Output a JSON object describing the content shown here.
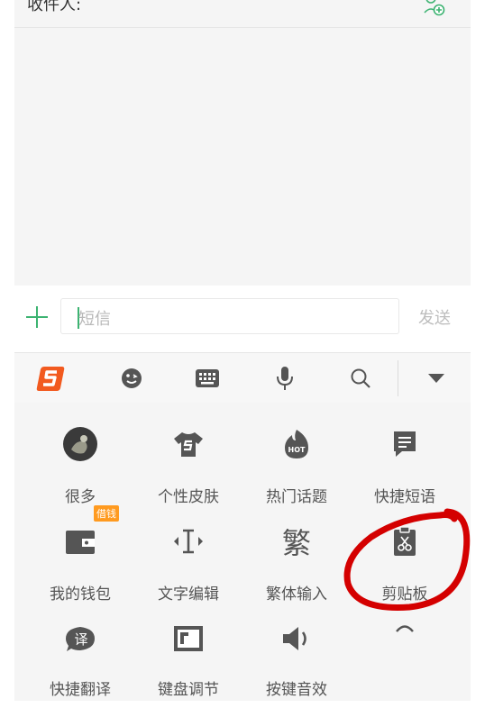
{
  "recipient": {
    "label": "收件人:"
  },
  "compose": {
    "placeholder": "短信",
    "send_label": "发送"
  },
  "toolbar": {
    "items": [
      "sogou-logo-icon",
      "emoji-icon",
      "keyboard-icon",
      "microphone-icon",
      "search-icon",
      "collapse-icon"
    ]
  },
  "grid": {
    "items": [
      {
        "label": "很多",
        "icon": "avatar-icon"
      },
      {
        "label": "个性皮肤",
        "icon": "skin-shirt-icon"
      },
      {
        "label": "热门话题",
        "icon": "hot-topic-icon"
      },
      {
        "label": "快捷短语",
        "icon": "quick-phrase-icon"
      },
      {
        "label": "我的钱包",
        "icon": "wallet-icon",
        "badge": "借钱"
      },
      {
        "label": "文字编辑",
        "icon": "text-edit-icon"
      },
      {
        "label": "繁体输入",
        "icon": "traditional-chinese-icon",
        "glyph": "繁"
      },
      {
        "label": "剪贴板",
        "icon": "clipboard-icon"
      },
      {
        "label": "快捷翻译",
        "icon": "translate-icon",
        "glyph": "译"
      },
      {
        "label": "键盘调节",
        "icon": "keyboard-resize-icon"
      },
      {
        "label": "按键音效",
        "icon": "key-sound-icon"
      },
      {
        "label": "",
        "icon": "expand-up-icon"
      }
    ]
  },
  "colors": {
    "accent_green": "#3cb371",
    "sogou_orange": "#f25a1f",
    "badge_orange": "#ff9a1f",
    "annotation_red": "#d40000"
  }
}
